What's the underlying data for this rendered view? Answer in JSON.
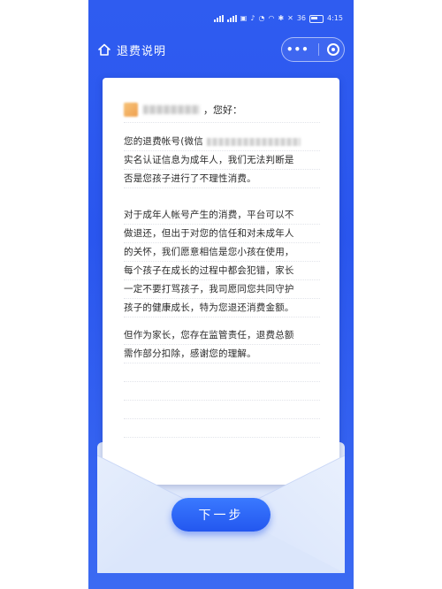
{
  "status_bar": {
    "battery": "36",
    "time": "4:15"
  },
  "nav": {
    "title": "退费说明",
    "more_glyph": "•••"
  },
  "letter": {
    "greeting": "，您好：",
    "lines": [
      "您的退费帐号(微信",
      "实名认证信息为成年人，我们无法判断是",
      "否是您孩子进行了不理性消费。",
      "对于成年人帐号产生的消费，平台可以不",
      "做退还，但出于对您的信任和对未成年人",
      "的关怀，我们愿意相信是您小孩在使用，",
      "每个孩子在成长的过程中都会犯错，家长",
      "一定不要打骂孩子，我司愿同您共同守护",
      "孩子的健康成长，特为您退还消费金额。",
      "但作为家长，您存在监管责任，退费总额",
      "需作部分扣除，感谢您的理解。"
    ]
  },
  "actions": {
    "next_label": "下一步"
  },
  "icons": {
    "home": "home-icon",
    "more": "more-dots-icon",
    "close": "target-icon"
  },
  "colors": {
    "primary": "#2f5cf0",
    "button": "#2357ef",
    "envelope": "#dfe8fb"
  }
}
